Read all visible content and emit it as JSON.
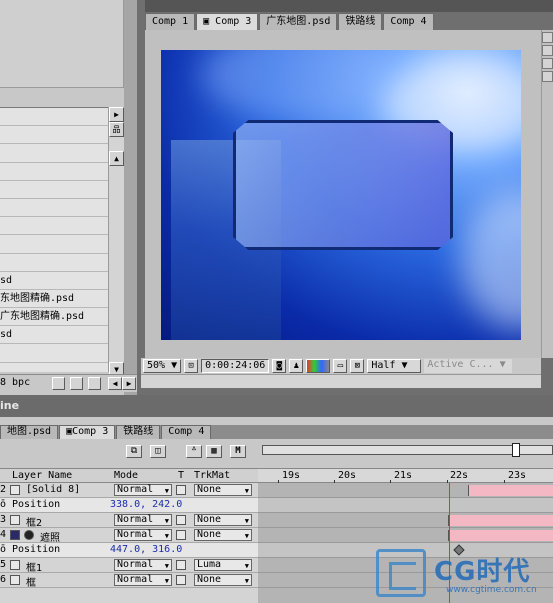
{
  "project_panel": {
    "items": [
      "",
      "",
      "",
      "",
      "",
      "",
      "",
      "",
      "",
      "sd",
      "东地图精确.psd",
      "广东地图精确.psd",
      "sd",
      "",
      ""
    ],
    "bpc_label": "8 bpc"
  },
  "comp_viewer": {
    "tabs": [
      "Comp 1",
      "Comp 3",
      "广东地图.psd",
      "铁路线",
      "Comp 4"
    ],
    "active_tab": 1,
    "zoom": "50%",
    "timecode": "0:00:24:06",
    "resolution": "Half",
    "camera": "Active C..."
  },
  "timeline": {
    "title": "ine",
    "tabs": [
      "地图.psd",
      "Comp 3",
      "铁路线",
      "Comp 4"
    ],
    "active_tab": 1,
    "columns": {
      "layer_name": "Layer Name",
      "mode": "Mode",
      "t": "T",
      "trkmat": "TrkMat"
    },
    "ruler": [
      "19s",
      "20s",
      "21s",
      "22s",
      "23s"
    ],
    "layers": [
      {
        "num": "2",
        "name": "[Solid 8]",
        "mode": "Normal",
        "trkmat": "None",
        "bar": true
      },
      {
        "num": "",
        "name": "Position",
        "value": "338.0, 242.0",
        "sub": true
      },
      {
        "num": "3",
        "name": "框2",
        "mode": "Normal",
        "trkmat": "None",
        "bar": true
      },
      {
        "num": "4",
        "name": "遮照",
        "mode": "Normal",
        "trkmat": "None",
        "bar": true
      },
      {
        "num": "",
        "name": "Position",
        "value": "447.0, 316.0",
        "sub": true,
        "keyframe": true
      },
      {
        "num": "5",
        "name": "框1",
        "mode": "Normal",
        "trkmat": "Luma",
        "bar": false
      },
      {
        "num": "6",
        "name": "框",
        "mode": "Normal",
        "trkmat": "None",
        "bar": false
      }
    ]
  },
  "watermark": {
    "brand": "CG时代",
    "url": "www.cgtime.com.cn"
  },
  "colors": {
    "bar": "#f3b8c3",
    "value": "#1a2ca8",
    "title_bg": "#6b6b6b"
  }
}
